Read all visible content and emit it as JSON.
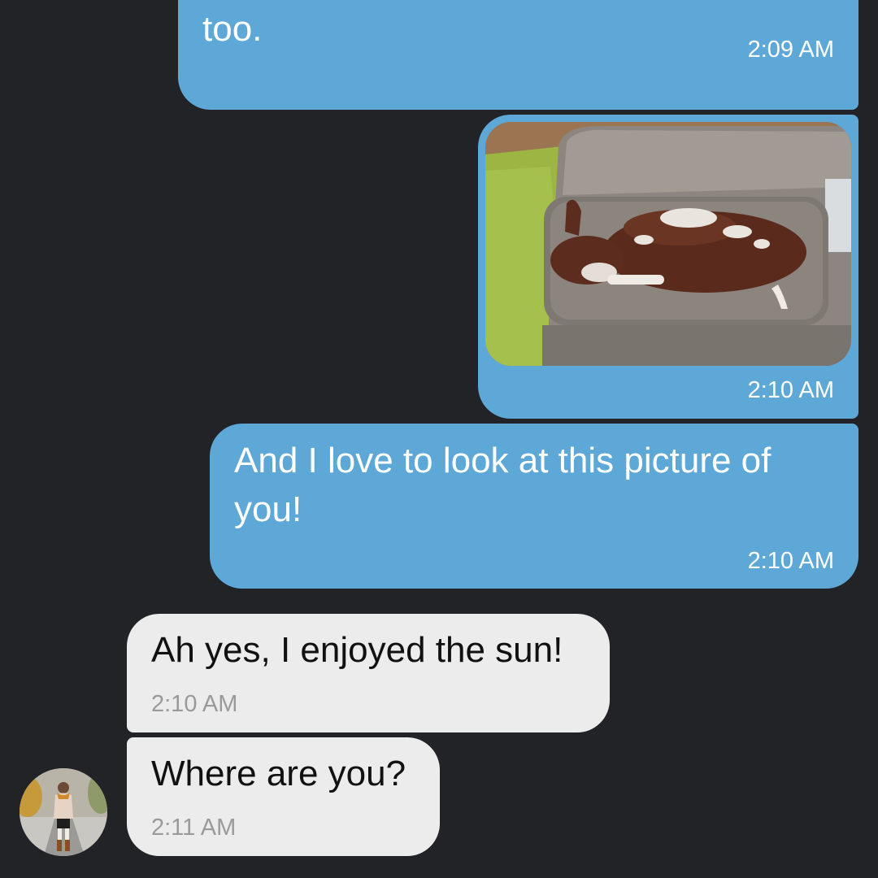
{
  "conversation": {
    "messages": [
      {
        "direction": "sent",
        "text": "too.",
        "time": "2:09 AM"
      },
      {
        "direction": "sent",
        "type": "image",
        "image_desc": "dog-on-couch-photo",
        "time": "2:10 AM"
      },
      {
        "direction": "sent",
        "text": "And I love to look at this picture of you!",
        "time": "2:10 AM"
      },
      {
        "direction": "received",
        "text": "Ah yes, I enjoyed the sun!",
        "time": "2:10 AM"
      },
      {
        "direction": "received",
        "text": "Where are you?",
        "time": "2:11 AM"
      }
    ]
  },
  "colors": {
    "background": "#212327",
    "sent_bubble": "#5ea8d8",
    "received_bubble": "#ececec",
    "received_time": "#9a9a9a"
  }
}
